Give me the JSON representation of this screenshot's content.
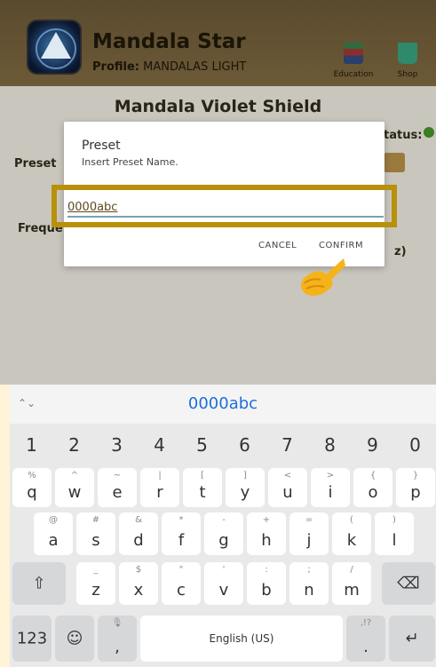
{
  "header": {
    "title": "Mandala Star",
    "profile_label": "Profile:",
    "profile_name": "MANDALAS LIGHT",
    "education_label": "Education",
    "shop_label": "Shop"
  },
  "background_page": {
    "title": "Mandala Violet Shield",
    "preset_label": "Preset",
    "freq_label": "Freque",
    "status_label": "tatus:",
    "hz_label": "z)"
  },
  "dialog": {
    "title": "Preset",
    "message": "Insert Preset Name.",
    "input_value": "0000abc",
    "cancel_label": "CANCEL",
    "confirm_label": "CONFIRM"
  },
  "keyboard": {
    "suggestion": "0000abc",
    "number_row": [
      "1",
      "2",
      "3",
      "4",
      "5",
      "6",
      "7",
      "8",
      "9",
      "0"
    ],
    "row1": [
      {
        "main": "q",
        "sub": "%"
      },
      {
        "main": "w",
        "sub": "^"
      },
      {
        "main": "e",
        "sub": "~"
      },
      {
        "main": "r",
        "sub": "|"
      },
      {
        "main": "t",
        "sub": "["
      },
      {
        "main": "y",
        "sub": "]"
      },
      {
        "main": "u",
        "sub": "<"
      },
      {
        "main": "i",
        "sub": ">"
      },
      {
        "main": "o",
        "sub": "{"
      },
      {
        "main": "p",
        "sub": "}"
      }
    ],
    "row2": [
      {
        "main": "a",
        "sub": "@"
      },
      {
        "main": "s",
        "sub": "#"
      },
      {
        "main": "d",
        "sub": "&"
      },
      {
        "main": "f",
        "sub": "*"
      },
      {
        "main": "g",
        "sub": "-"
      },
      {
        "main": "h",
        "sub": "+"
      },
      {
        "main": "j",
        "sub": "="
      },
      {
        "main": "k",
        "sub": "("
      },
      {
        "main": "l",
        "sub": ")"
      }
    ],
    "row3": [
      {
        "main": "z",
        "sub": "_"
      },
      {
        "main": "x",
        "sub": "$"
      },
      {
        "main": "c",
        "sub": "\""
      },
      {
        "main": "v",
        "sub": "'"
      },
      {
        "main": "b",
        "sub": ":"
      },
      {
        "main": "n",
        "sub": ";"
      },
      {
        "main": "m",
        "sub": "/"
      }
    ],
    "symbols_label": "123",
    "comma_label": ",",
    "space_label": "English (US)",
    "period_label": ".",
    "period_sub": ",!?"
  },
  "colors": {
    "highlight_border": "#b8900a",
    "accent_blue": "#1d6fd8"
  }
}
